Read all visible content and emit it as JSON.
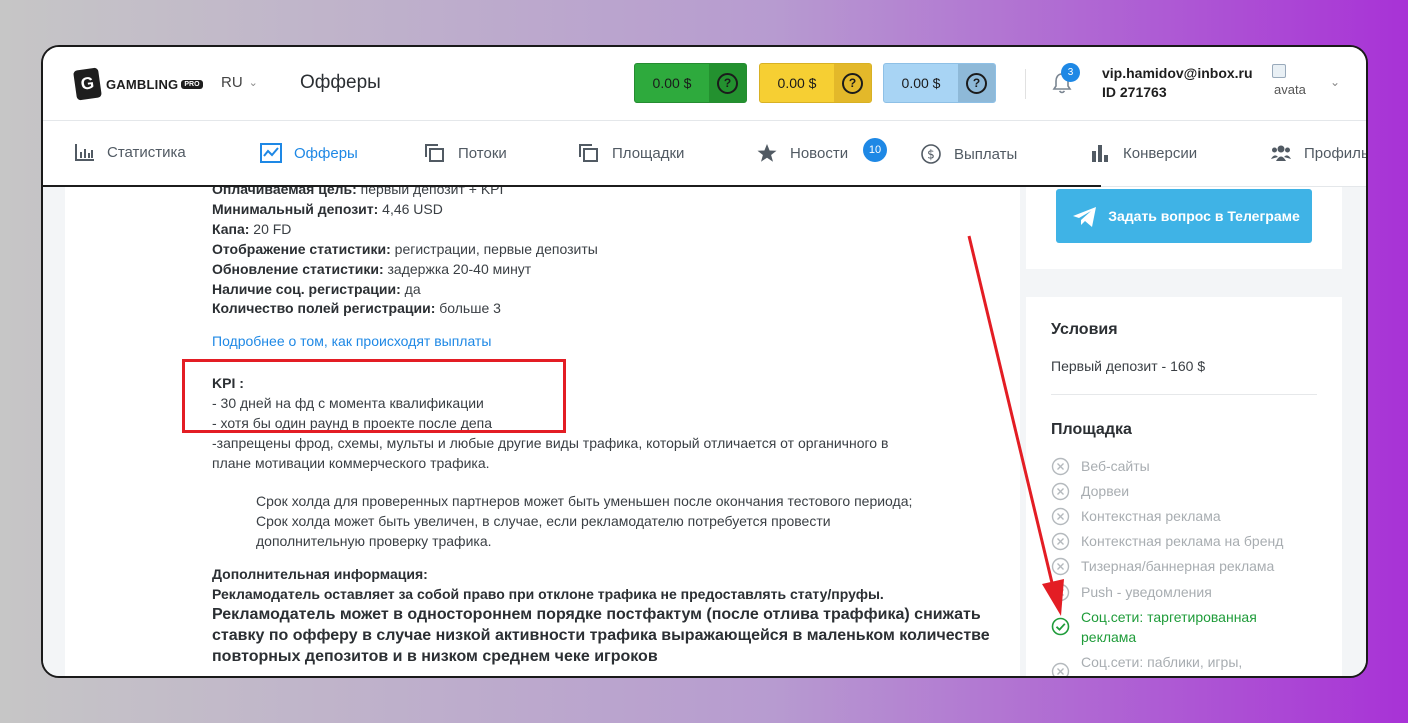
{
  "header": {
    "brand": "GAMBLING",
    "brand_badge": "PRO",
    "lang": "RU",
    "page_title": "Офферы",
    "balances": [
      {
        "amount": "0.00 $",
        "help": "?",
        "color": "#2eaa3d"
      },
      {
        "amount": "0.00 $",
        "help": "?",
        "color": "#f6cf33"
      },
      {
        "amount": "0.00 $",
        "help": "?",
        "color": "#a8d4f4"
      }
    ],
    "notifications_count": "3",
    "user_email": "vip.hamidov@inbox.ru",
    "user_id": "ID 271763",
    "avatar_alt": "avata"
  },
  "nav": {
    "items": [
      {
        "label": "Статистика",
        "icon": "bar-chart-icon"
      },
      {
        "label": "Офферы",
        "icon": "trend-icon",
        "active": true
      },
      {
        "label": "Потоки",
        "icon": "copy-icon"
      },
      {
        "label": "Площадки",
        "icon": "copy-icon"
      },
      {
        "label": "Новости",
        "icon": "star-icon"
      },
      {
        "label": "Выплаты",
        "icon": "dollar-circle-icon"
      },
      {
        "label": "Конверсии",
        "icon": "bars-icon"
      },
      {
        "label": "Профиль",
        "icon": "users-icon"
      }
    ],
    "news_badge": "10"
  },
  "offer": {
    "cut_line": {
      "k": "Оплачиваемая цель:",
      "v": " первый депозит + KPI"
    },
    "details": [
      {
        "k": "Минимальный депозит:",
        "v": " 4,46 USD"
      },
      {
        "k": "Капа:",
        "v": " 20 FD"
      },
      {
        "k": "Отображение статистики:",
        "v": " регистрации, первые депозиты"
      },
      {
        "k": "Обновление статистики:",
        "v": " задержка 20-40 минут"
      },
      {
        "k": "Наличие соц. регистрации:",
        "v": " да"
      },
      {
        "k": "Количество полей регистрации:",
        "v": " больше 3"
      }
    ],
    "payout_link": "Подробнее о том, как происходят выплаты",
    "kpi_title": "KPI :",
    "kpi_lines": [
      "- 30 дней на фд с момента квалификации",
      "- хотя бы один раунд в проекте после депа"
    ],
    "forbidden_line1": "-запрещены фрод, схемы, мульты и любые другие виды трафика, который отличается от органичного в",
    "forbidden_line2": "плане мотивации коммерческого трафика.",
    "hold_lines": [
      "Срок холда для проверенных партнеров может быть уменьшен после окончания тестового периода;",
      "Срок холда может быть увеличен, в случае, если рекламодателю потребуется провести",
      "дополнительную проверку трафика."
    ],
    "extra_title": "Дополнительная информация:",
    "extra_line": "Рекламодатель оставляет за собой право при отклоне трафика не предоставлять стату/пруфы.",
    "extra_big": "Рекламодатель может в одностороннем порядке постфактум (после отлива траффика) снижать ставку по офферу в случае низкой активности трафика выражающейся в маленьком количестве повторных депозитов и в низком среднем чеке игроков"
  },
  "sidebar": {
    "telegram_button": "Задать вопрос в Телеграме",
    "conditions_title": "Условия",
    "conditions_text": "Первый депозит - 160 $",
    "platform_title": "Площадка",
    "platforms": [
      {
        "label": "Веб-сайты",
        "allowed": false
      },
      {
        "label": "Дорвеи",
        "allowed": false
      },
      {
        "label": "Контекстная реклама",
        "allowed": false
      },
      {
        "label": "Контекстная реклама на бренд",
        "allowed": false
      },
      {
        "label": "Тизерная/баннерная реклама",
        "allowed": false
      },
      {
        "label": "Push - уведомления",
        "allowed": false
      },
      {
        "label": "Соц.сети: таргетированная реклама",
        "allowed": true
      },
      {
        "label": "Соц.сети: паблики, игры,",
        "allowed": false
      }
    ]
  },
  "colors": {
    "accent": "#1e88e5",
    "highlight_box": "#e31d24",
    "allowed": "#1f9c3a",
    "telegram": "#3fb3e6"
  }
}
